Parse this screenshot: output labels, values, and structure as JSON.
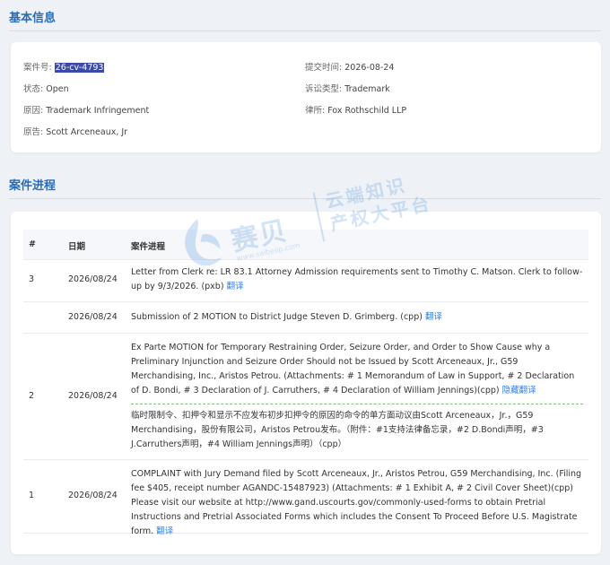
{
  "basic_info": {
    "title": "基本信息",
    "case_number_label": "案件号:",
    "case_number": "26-cv-4793",
    "status_label": "状态:",
    "status": "Open",
    "cause_label": "原因:",
    "cause": "Trademark Infringement",
    "plaintiff_label": "原告:",
    "plaintiff": "Scott Arceneaux, Jr",
    "filed_label": "提交时间:",
    "filed": "2026-08-24",
    "suit_type_label": "诉讼类型:",
    "suit_type": "Trademark",
    "lawyer_label": "律所:",
    "lawyer": "Fox Rothschild LLP"
  },
  "progress": {
    "title": "案件进程",
    "headers": {
      "num": "#",
      "date": "日期",
      "desc": "案件进程"
    },
    "translate_label": "翻译",
    "hide_translate_label": "隐藏翻译",
    "rows": [
      {
        "num": "3",
        "date": "2026/08/24",
        "desc": "Letter from Clerk re: LR 83.1 Attorney Admission requirements sent to Timothy C. Matson. Clerk to follow-up by 9/3/2026. (pxb)"
      },
      {
        "num": "",
        "date": "2026/08/24",
        "desc": "Submission of 2 MOTION to District Judge Steven D. Grimberg. (cpp)"
      },
      {
        "num": "2",
        "date": "2026/08/24",
        "desc": "Ex Parte MOTION for Temporary Restraining Order, Seizure Order, and Order to Show Cause why a Preliminary Injunction and Seizure Order Should not be Issued by Scott Arceneaux, Jr., G59 Merchandising, Inc., Aristos Petrou. (Attachments: # 1 Memorandum of Law in Support, # 2 Declaration of D. Bondi, # 3 Declaration of J. Carruthers, # 4 Declaration of William Jennings)(cpp)",
        "translation": "临时限制令、扣押令和显示不应发布初步扣押令的原因的命令的单方面动议由Scott Arceneaux，Jr.，G59 Merchandising，股份有限公司，Aristos Petrou发布。（附件：#1支持法律备忘录，#2 D.Bondi声明，#3 J.Carruthers声明，#4 William Jennings声明）（cpp）"
      },
      {
        "num": "1",
        "date": "2026/08/24",
        "desc": "COMPLAINT with Jury Demand filed by Scott Arceneaux, Jr., Aristos Petrou, G59 Merchandising, Inc. (Filing fee $405, receipt number AGANDC-15487923) (Attachments: # 1 Exhibit A, # 2 Civil Cover Sheet)(cpp) Please visit our website at http://www.gand.uscourts.gov/commonly-used-forms to obtain Pretrial Instructions and Pretrial Associated Forms which includes the Consent To Proceed Before U.S. Magistrate form."
      }
    ]
  },
  "watermark": {
    "brand": "赛贝",
    "slogan_line1": "云端知识",
    "slogan_line2": "产权大平台",
    "url": "www.saibeiip.com"
  },
  "colors": {
    "title_blue": "#2b6cb5",
    "link_blue": "#2f80ed",
    "highlight": "#3b4aa8",
    "dashed_green": "#7fc37a"
  }
}
